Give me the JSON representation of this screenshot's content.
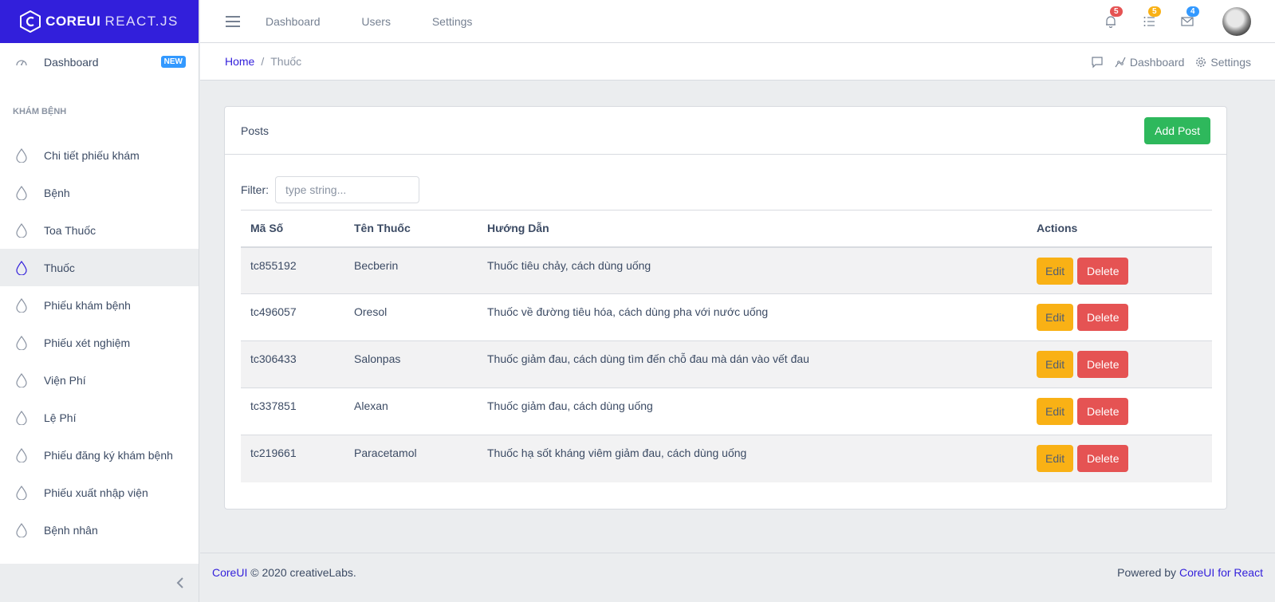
{
  "brand": {
    "name_bold": "COREUI",
    "name_light": "REACT.JS"
  },
  "sidebar": {
    "top_item": {
      "label": "Dashboard",
      "badge": "NEW"
    },
    "section_title": "KHÁM BỆNH",
    "items": [
      {
        "label": "Chi tiết phiếu khám"
      },
      {
        "label": "Bệnh"
      },
      {
        "label": "Toa Thuốc"
      },
      {
        "label": "Thuốc"
      },
      {
        "label": "Phiếu khám bệnh"
      },
      {
        "label": "Phiếu xét nghiệm"
      },
      {
        "label": "Viện Phí"
      },
      {
        "label": "Lệ Phí"
      },
      {
        "label": "Phiếu đăng ký khám bệnh"
      },
      {
        "label": "Phiếu xuất nhập viện"
      },
      {
        "label": "Bệnh nhân"
      }
    ],
    "active_index": 3
  },
  "header": {
    "nav": [
      "Dashboard",
      "Users",
      "Settings"
    ],
    "badges": {
      "notifications": "5",
      "tasks": "5",
      "messages": "4"
    },
    "badge_colors": {
      "notifications": "#e55353",
      "tasks": "#f9b115",
      "messages": "#39f"
    }
  },
  "breadcrumb": {
    "home": "Home",
    "separator": "/",
    "current": "Thuốc"
  },
  "subheader": {
    "dashboard": "Dashboard",
    "settings": "Settings"
  },
  "card": {
    "title": "Posts",
    "add_button": "Add Post",
    "filter_label": "Filter:",
    "filter_placeholder": "type string...",
    "columns": [
      "Mã Số",
      "Tên Thuốc",
      "Hướng Dẫn",
      "Actions"
    ],
    "rows": [
      {
        "code": "tc855192",
        "name": "Becberin",
        "guide": "Thuốc tiêu chảy, cách dùng uống"
      },
      {
        "code": "tc496057",
        "name": "Oresol",
        "guide": "Thuốc về đường tiêu hóa, cách dùng pha với nước uống"
      },
      {
        "code": "tc306433",
        "name": "Salonpas",
        "guide": "Thuốc giảm đau, cách dùng tìm đến chỗ đau mà dán vào vết đau"
      },
      {
        "code": "tc337851",
        "name": "Alexan",
        "guide": "Thuốc giảm đau, cách dùng uống"
      },
      {
        "code": "tc219661",
        "name": "Paracetamol",
        "guide": "Thuốc hạ sốt kháng viêm giảm đau, cách dùng uống"
      }
    ],
    "edit_label": "Edit",
    "delete_label": "Delete"
  },
  "footer": {
    "brand_link": "CoreUI",
    "copyright": "© 2020 creativeLabs.",
    "powered_by": "Powered by",
    "powered_link": "CoreUI for React"
  }
}
